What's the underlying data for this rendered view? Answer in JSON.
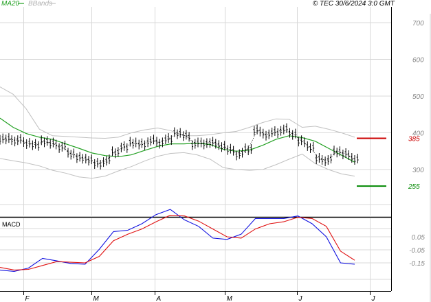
{
  "header": {
    "legend_ma": "MA20",
    "legend_bb": "BBands",
    "copyright": "© TEC 30/6/2024 3:0 GMT"
  },
  "colors": {
    "ma": "#22a022",
    "bbands": "#c0c0c0",
    "price": "#000000",
    "macd_blue": "#1010e0",
    "macd_red": "#e01010",
    "resistance": "#cc0000",
    "support": "#008800",
    "grid": "#d8d8d8",
    "axis_text": "#888888"
  },
  "chart_data": [
    {
      "type": "line",
      "panel": "price",
      "y_ticks": [
        700,
        600,
        500,
        400,
        300
      ],
      "ylim": [
        210,
        720
      ],
      "legend": [
        "MA20",
        "BBands"
      ],
      "levels": [
        {
          "label": "385",
          "value": 385,
          "color": "#cc0000"
        },
        {
          "label": "255",
          "value": 255,
          "color": "#008800"
        }
      ],
      "series": [
        {
          "name": "MA20",
          "values": [
            440,
            415,
            398,
            388,
            382,
            370,
            358,
            345,
            338,
            335,
            340,
            352,
            363,
            370,
            370,
            372,
            368,
            355,
            350,
            353,
            366,
            382,
            392,
            387,
            377,
            358,
            339,
            320
          ]
        },
        {
          "name": "BBands",
          "role": "upper",
          "values": [
            525,
            505,
            465,
            410,
            392,
            390,
            388,
            386,
            385,
            388,
            400,
            408,
            413,
            406,
            392,
            392,
            395,
            400,
            404,
            415,
            428,
            438,
            437,
            415,
            418,
            410,
            400,
            388
          ]
        },
        {
          "name": "BBands",
          "role": "lower",
          "values": [
            330,
            324,
            318,
            310,
            298,
            290,
            280,
            276,
            282,
            296,
            308,
            323,
            336,
            344,
            346,
            340,
            328,
            305,
            300,
            298,
            300,
            313,
            328,
            342,
            316,
            300,
            288,
            282
          ]
        },
        {
          "name": "Price",
          "values": [
            383,
            382,
            380,
            373,
            368,
            376,
            370,
            362,
            344,
            333,
            326,
            315,
            324,
            348,
            362,
            372,
            368,
            378,
            374,
            384,
            398,
            391,
            370,
            372,
            374,
            363,
            353,
            342,
            356,
            407,
            394,
            401,
            409,
            398,
            378,
            360,
            328,
            326,
            350,
            343,
            328
          ]
        }
      ]
    },
    {
      "type": "line",
      "panel": "macd",
      "title": "MACD",
      "y_ticks": [
        "0.05",
        "-0.05",
        "-0.15"
      ],
      "ylim": [
        -0.22,
        0.36
      ],
      "series": [
        {
          "name": "MACD",
          "color": "#1010e0",
          "values": [
            -0.205,
            -0.215,
            -0.19,
            -0.115,
            -0.135,
            -0.155,
            -0.16,
            -0.045,
            0.09,
            0.1,
            0.15,
            0.22,
            0.26,
            0.18,
            0.13,
            0.04,
            0.03,
            0.07,
            0.19,
            0.19,
            0.19,
            0.21,
            0.15,
            0.05,
            -0.15,
            -0.16
          ]
        },
        {
          "name": "Signal",
          "color": "#e01010",
          "values": [
            -0.185,
            -0.205,
            -0.2,
            -0.17,
            -0.14,
            -0.145,
            -0.15,
            -0.1,
            0.02,
            0.07,
            0.11,
            0.165,
            0.215,
            0.21,
            0.17,
            0.11,
            0.05,
            0.04,
            0.11,
            0.15,
            0.165,
            0.2,
            0.19,
            0.13,
            -0.06,
            -0.13
          ]
        }
      ]
    }
  ],
  "x_axis": {
    "months": [
      {
        "label": "F",
        "pos": 0.06
      },
      {
        "label": "M",
        "pos": 0.233
      },
      {
        "label": "A",
        "pos": 0.395
      },
      {
        "label": "M",
        "pos": 0.575
      },
      {
        "label": "J",
        "pos": 0.76
      },
      {
        "label": "J",
        "pos": 0.945
      }
    ]
  }
}
